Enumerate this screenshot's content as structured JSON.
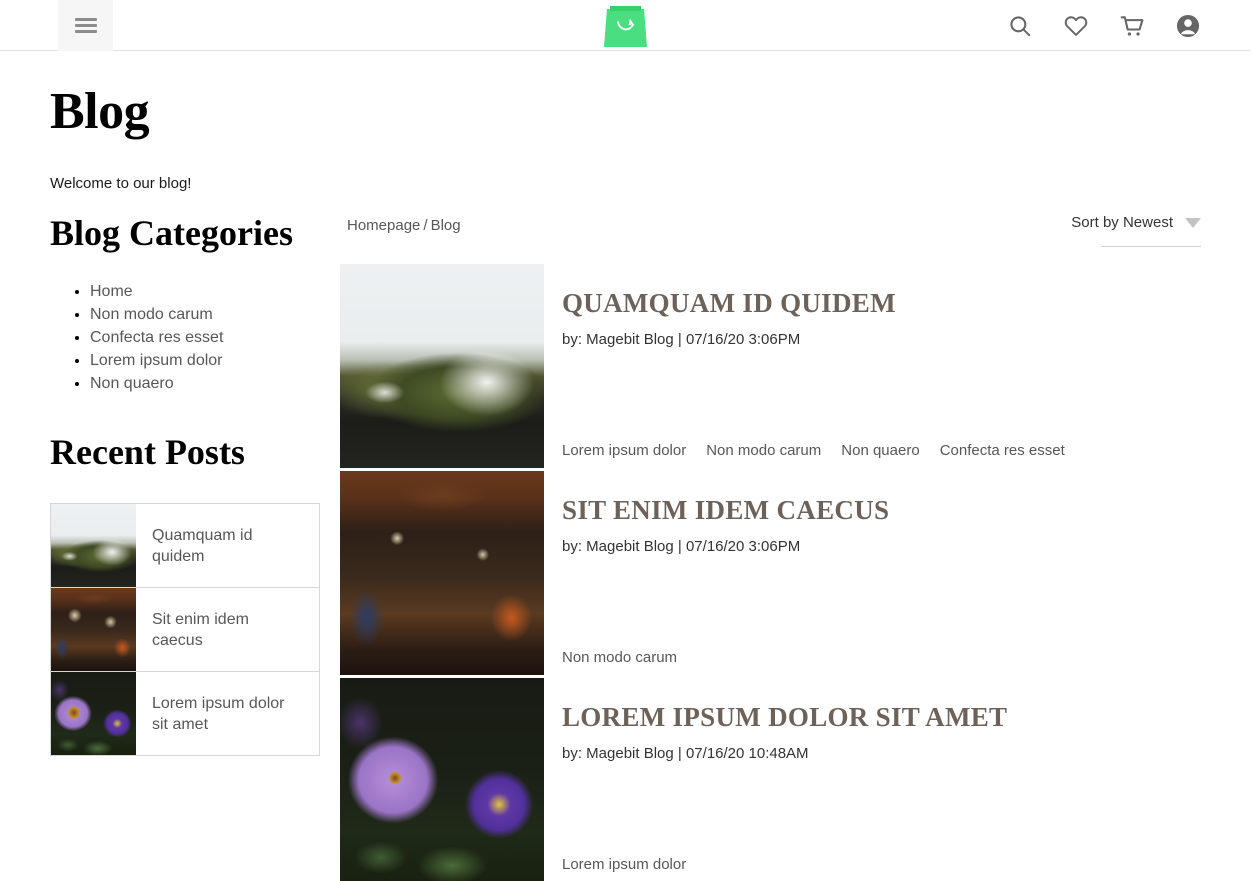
{
  "header": {
    "menu_icon": "hamburger-menu-icon",
    "logo_icon": "shopping-bag-logo",
    "logo_color": "#4ade80",
    "icons": [
      {
        "name": "search-icon",
        "label": "Search"
      },
      {
        "name": "wishlist-heart-icon",
        "label": "Wishlist"
      },
      {
        "name": "shopping-cart-icon",
        "label": "Cart"
      },
      {
        "name": "account-icon",
        "label": "Account"
      }
    ]
  },
  "page": {
    "title": "Blog",
    "welcome": "Welcome to our blog!"
  },
  "sidebar": {
    "categories_heading": "Blog Categories",
    "categories": [
      {
        "label": "Home"
      },
      {
        "label": "Non modo carum"
      },
      {
        "label": "Confecta res esset"
      },
      {
        "label": "Lorem ipsum dolor"
      },
      {
        "label": "Non quaero"
      }
    ],
    "recent_heading": "Recent Posts",
    "recent_posts": [
      {
        "title": "Quamquam id quidem",
        "image": "mountain"
      },
      {
        "title": "Sit enim idem caecus",
        "image": "pub"
      },
      {
        "title": "Lorem ipsum dolor sit amet",
        "image": "flower"
      }
    ]
  },
  "main": {
    "breadcrumb": {
      "home": "Homepage",
      "separator": "/",
      "current": "Blog"
    },
    "sorter": {
      "label": "Sort by Newest",
      "caret_icon": "chevron-down-icon"
    },
    "posts": [
      {
        "title": "QUAMQUAM ID QUIDEM",
        "meta": "by: Magebit Blog | 07/16/20 3:06PM",
        "image": "mountain",
        "tags": [
          "Lorem ipsum dolor",
          "Non modo carum",
          "Non quaero",
          "Confecta res esset"
        ]
      },
      {
        "title": "SIT ENIM IDEM CAECUS",
        "meta": "by: Magebit Blog | 07/16/20 3:06PM",
        "image": "pub",
        "tags": [
          "Non modo carum"
        ]
      },
      {
        "title": "LOREM IPSUM DOLOR SIT AMET",
        "meta": "by: Magebit Blog | 07/16/20 10:48AM",
        "image": "flower",
        "tags": [
          "Lorem ipsum dolor"
        ]
      }
    ]
  }
}
